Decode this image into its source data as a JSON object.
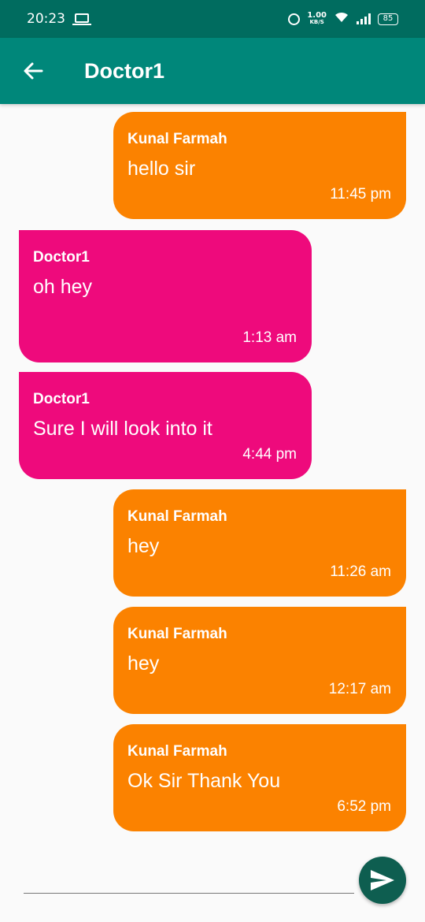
{
  "status_bar": {
    "time": "20:23",
    "speed_value": "1.00",
    "speed_unit": "KB/S",
    "battery": "85"
  },
  "header": {
    "title": "Doctor1"
  },
  "messages": [
    {
      "sender": "Kunal Farmah",
      "text": "hello sir",
      "time": "11:45 pm",
      "side": "outgoing"
    },
    {
      "sender": "Doctor1",
      "text": "oh hey",
      "time": "1:13 am",
      "side": "incoming"
    },
    {
      "sender": "Doctor1",
      "text": "Sure I will look into it",
      "time": "4:44 pm",
      "side": "incoming"
    },
    {
      "sender": "Kunal Farmah",
      "text": "hey",
      "time": "11:26 am",
      "side": "outgoing"
    },
    {
      "sender": "Kunal Farmah",
      "text": "hey",
      "time": "12:17 am",
      "side": "outgoing"
    },
    {
      "sender": "Kunal Farmah",
      "text": "Ok Sir Thank You",
      "time": "6:52 pm",
      "side": "outgoing"
    }
  ],
  "composer": {
    "input_value": "",
    "placeholder": ""
  },
  "colors": {
    "app_bar": "#00877a",
    "status_bar": "#006c5f",
    "outgoing_bubble": "#fb8200",
    "incoming_bubble": "#ee0a7c",
    "send_button": "#0e5e50"
  },
  "icons": {
    "back": "arrow-back-icon",
    "send": "send-icon",
    "alarm": "alarm-icon",
    "wifi": "wifi-icon",
    "signal": "signal-icon",
    "battery": "battery-icon",
    "laptop": "laptop-icon"
  }
}
